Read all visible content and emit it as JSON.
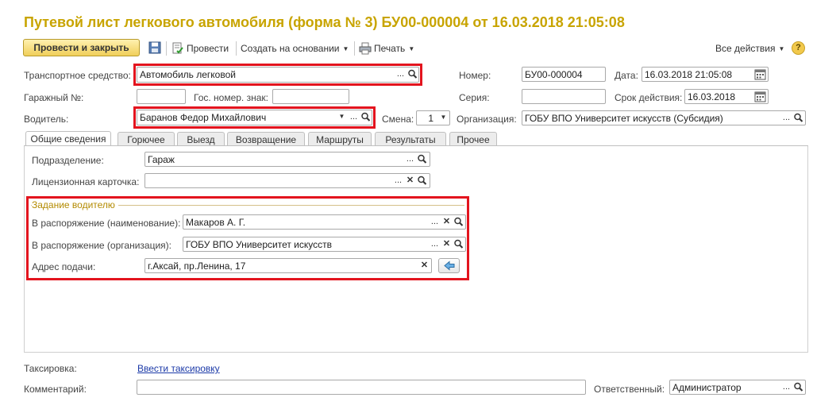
{
  "window": {
    "title": "Путевой лист легкового автомобиля (форма № 3) БУ00-000004 от 16.03.2018 21:05:08"
  },
  "toolbar": {
    "post_and_close": "Провести и закрыть",
    "post": "Провести",
    "create_based_on": "Создать на основании",
    "print": "Печать",
    "all_actions": "Все действия",
    "help": "?"
  },
  "header": {
    "vehicle_label": "Транспортное средство:",
    "vehicle_value": "Автомобиль легковой",
    "number_label": "Номер:",
    "number_value": "БУ00-000004",
    "date_label": "Дата:",
    "date_value": "16.03.2018 21:05:08",
    "garage_label": "Гаражный №:",
    "garage_value": "",
    "plate_label": "Гос. номер. знак:",
    "plate_value": "",
    "series_label": "Серия:",
    "series_value": "",
    "validity_label": "Срок действия:",
    "validity_value": "16.03.2018",
    "driver_label": "Водитель:",
    "driver_value": "Баранов Федор Михайлович",
    "shift_label": "Смена:",
    "shift_value": "1",
    "org_label": "Организация:",
    "org_value": "ГОБУ ВПО Университет искусств (Субсидия)"
  },
  "tabs": [
    {
      "label": "Общие сведения"
    },
    {
      "label": "Горючее"
    },
    {
      "label": "Выезд"
    },
    {
      "label": "Возвращение"
    },
    {
      "label": "Маршруты"
    },
    {
      "label": "Результаты"
    },
    {
      "label": "Прочее"
    }
  ],
  "general": {
    "division_label": "Подразделение:",
    "division_value": "Гараж",
    "license_label": "Лицензионная карточка:",
    "license_value": "",
    "task_group_title": "Задание водителю",
    "disposal_name_label": "В распоряжение (наименование):",
    "disposal_name_value": "Макаров А. Г.",
    "disposal_org_label": "В распоряжение (организация):",
    "disposal_org_value": "ГОБУ ВПО Университет искусств",
    "address_label": "Адрес подачи:",
    "address_value": "г.Аксай, пр.Ленина, 17"
  },
  "footer": {
    "taxation_label": "Таксировка:",
    "taxation_link": "Ввести таксировку",
    "comment_label": "Комментарий:",
    "comment_value": "",
    "responsible_label": "Ответственный:",
    "responsible_value": "Администратор"
  },
  "icons": {
    "ellipsis": "...",
    "search": "search-icon",
    "clear": "close-icon",
    "dropdown": "chevron-down-icon",
    "calendar": "calendar-icon",
    "save": "save-icon",
    "post": "post-document-icon",
    "print": "printer-icon",
    "map": "map-arrow-icon"
  },
  "colors": {
    "title": "#c8a400",
    "highlight": "#e3141e",
    "primary_button": "#f0cf5a",
    "link": "#1c3aa8"
  }
}
